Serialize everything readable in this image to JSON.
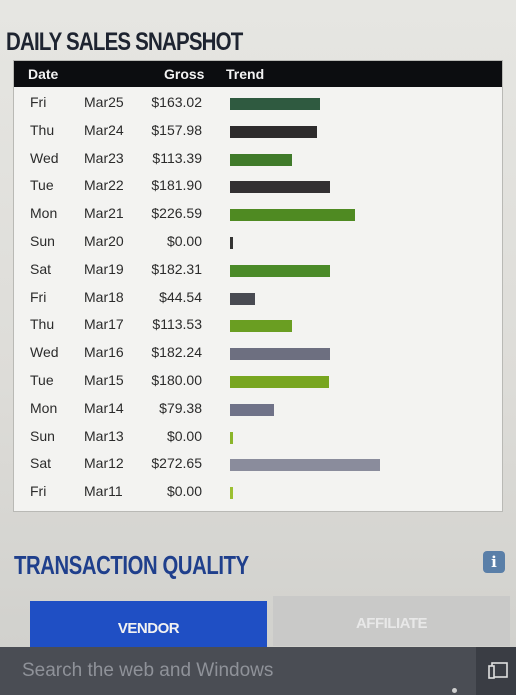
{
  "sales": {
    "title": "DAILY SALES SNAPSHOT",
    "headers": {
      "date": "Date",
      "gross": "Gross",
      "trend": "Trend"
    },
    "max_gross": 272.65,
    "rows": [
      {
        "day": "Fri",
        "date": "Mar25",
        "gross": "$163.02",
        "value": 163.02,
        "color": "#2f5a40"
      },
      {
        "day": "Thu",
        "date": "Mar24",
        "gross": "$157.98",
        "value": 157.98,
        "color": "#2d2b2c"
      },
      {
        "day": "Wed",
        "date": "Mar23",
        "gross": "$113.39",
        "value": 113.39,
        "color": "#3f7a2a"
      },
      {
        "day": "Tue",
        "date": "Mar22",
        "gross": "$181.90",
        "value": 181.9,
        "color": "#323032"
      },
      {
        "day": "Mon",
        "date": "Mar21",
        "gross": "$226.59",
        "value": 226.59,
        "color": "#4f8a22"
      },
      {
        "day": "Sun",
        "date": "Mar20",
        "gross": "$0.00",
        "value": 0,
        "color": "#333333"
      },
      {
        "day": "Sat",
        "date": "Mar19",
        "gross": "$182.31",
        "value": 182.31,
        "color": "#4a8a28"
      },
      {
        "day": "Fri",
        "date": "Mar18",
        "gross": "$44.54",
        "value": 44.54,
        "color": "#484a52"
      },
      {
        "day": "Thu",
        "date": "Mar17",
        "gross": "$113.53",
        "value": 113.53,
        "color": "#6a9e22"
      },
      {
        "day": "Wed",
        "date": "Mar16",
        "gross": "$182.24",
        "value": 182.24,
        "color": "#6d6f80"
      },
      {
        "day": "Tue",
        "date": "Mar15",
        "gross": "$180.00",
        "value": 180.0,
        "color": "#78a620"
      },
      {
        "day": "Mon",
        "date": "Mar14",
        "gross": "$79.38",
        "value": 79.38,
        "color": "#6f7288"
      },
      {
        "day": "Sun",
        "date": "Mar13",
        "gross": "$0.00",
        "value": 0,
        "color": "#8bb52a"
      },
      {
        "day": "Sat",
        "date": "Mar12",
        "gross": "$272.65",
        "value": 272.65,
        "color": "#8a8c9c"
      },
      {
        "day": "Fri",
        "date": "Mar11",
        "gross": "$0.00",
        "value": 0,
        "color": "#9cc032"
      }
    ]
  },
  "quality": {
    "title": "TRANSACTION QUALITY",
    "info_icon": "info-icon",
    "tabs": [
      {
        "label": "VENDOR",
        "active": true
      },
      {
        "label": "AFFILIATE",
        "active": false
      }
    ]
  },
  "taskbar": {
    "search_placeholder": "Search the web and Windows",
    "task_view_icon": "task-view-icon"
  },
  "colors": {
    "header_bg": "#0c0d10",
    "quality_title": "#1f3f8c",
    "vendor_tab": "#1f4fc4",
    "affiliate_tab": "#c9c9c8",
    "taskbar": "#3a3d44"
  }
}
